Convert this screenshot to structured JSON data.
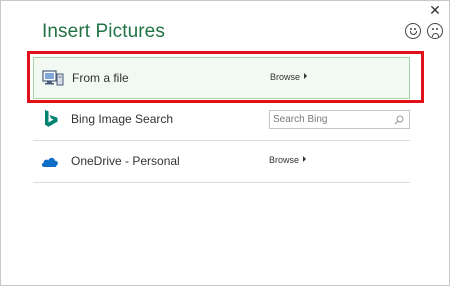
{
  "dialog": {
    "title": "Insert Pictures",
    "close_glyph": "✕"
  },
  "feedback": {
    "smile_icon": "smile-icon",
    "frown_icon": "frown-icon"
  },
  "sources": [
    {
      "label": "From a file",
      "icon": "computer-icon",
      "action_label": "Browse",
      "selected": true
    },
    {
      "label": "Bing Image Search",
      "icon": "bing-icon",
      "search_placeholder": "Search Bing"
    },
    {
      "label": "OneDrive - Personal",
      "icon": "onedrive-cloud-icon",
      "action_label": "Browse"
    }
  ],
  "colors": {
    "title_green": "#217346",
    "selected_row_bg": "#f2f9f2",
    "selected_row_border": "#a6d4a6",
    "highlight_red": "#e3101a",
    "bing_teal": "#008373",
    "onedrive_blue": "#0f6fc6"
  }
}
